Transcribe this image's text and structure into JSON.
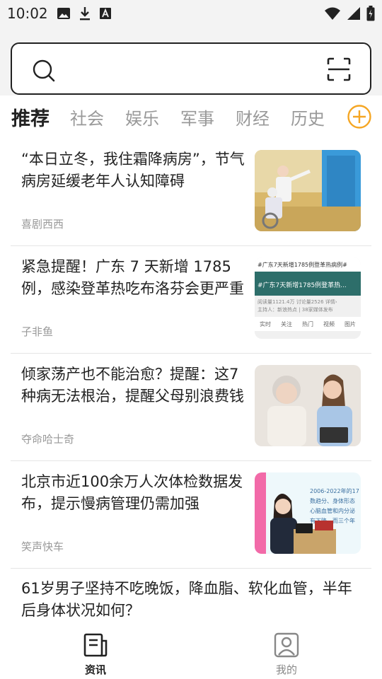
{
  "status_bar": {
    "time": "10:02",
    "left_icons": [
      "image-icon",
      "download-icon",
      "text-a-icon"
    ],
    "right_icons": [
      "wifi-icon",
      "signal-icon",
      "battery-icon"
    ]
  },
  "search": {
    "placeholder": "",
    "value": ""
  },
  "tabs": [
    {
      "label": "推荐",
      "active": true
    },
    {
      "label": "社会",
      "active": false
    },
    {
      "label": "娱乐",
      "active": false
    },
    {
      "label": "军事",
      "active": false
    },
    {
      "label": "财经",
      "active": false
    },
    {
      "label": "历史",
      "active": false
    }
  ],
  "feed": [
    {
      "title": "“本日立冬，我住霜降病房”，节气病房延缓老年人认知障碍",
      "source": "喜剧西西",
      "thumb": "hospital-corridor-photo"
    },
    {
      "title": "紧急提醒！广东 7 天新增 1785 例，感染登革热吃布洛芬会更严重",
      "source": "子非鱼",
      "thumb": "social-screenshot",
      "thumb_text": {
        "header": "#广东7天新增1785例登革热病例#",
        "banner": "#广东7天新增1785例登革热...",
        "stats": "阅读量1121.4万  讨论量2526  详情›",
        "host": "主持人：新浪热点 | 38家媒体发布",
        "tabs": [
          "实时",
          "关注",
          "热门",
          "视频",
          "图片"
        ]
      }
    },
    {
      "title": "倾家荡产也不能治愈？提醒：这7种病无法根治，提醒父母别浪费钱",
      "source": "夺命哈士奇",
      "thumb": "family-tablet-photo"
    },
    {
      "title": "北京市近100余万人次体检数据发布，提示慢病管理仍需加强",
      "source": "笑声快车",
      "thumb": "press-conference-photo",
      "thumb_text": {
        "line1": "2006-2022年的17",
        "line2": "数趋分、身体形态",
        "line3": "心脑血管和内分泌",
        "line4": "有下降，而三个年"
      }
    }
  ],
  "partial_item": {
    "title": "61岁男子坚持不吃晚饭，降血脂、软化血管，半年后身体状况如何？"
  },
  "bottom_nav": [
    {
      "label": "资讯",
      "icon": "news-icon",
      "active": true
    },
    {
      "label": "我的",
      "icon": "profile-icon",
      "active": false
    }
  ],
  "colors": {
    "accent": "#f5a623",
    "text_primary": "#222222",
    "text_muted": "#999999",
    "divider": "#e5e5e5",
    "header_bg": "#f3f3f3"
  }
}
